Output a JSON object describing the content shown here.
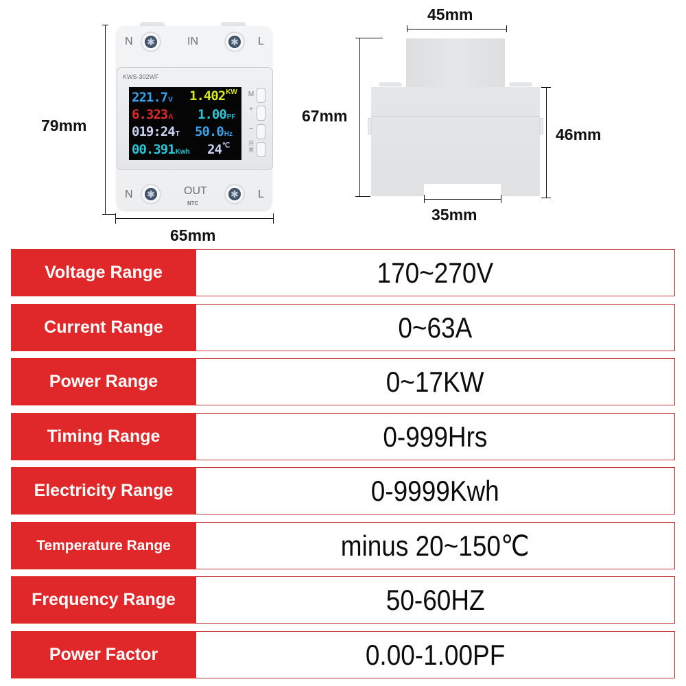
{
  "dimensions": {
    "front_height": "79mm",
    "front_width": "65mm",
    "side_top_width": "45mm",
    "side_total_height": "67mm",
    "side_body_height": "46mm",
    "rail_width": "35mm"
  },
  "device": {
    "model": "KWS-302WF",
    "top_terminals": {
      "left": "N",
      "center": "IN",
      "right": "L"
    },
    "bottom_terminals": {
      "left": "N",
      "center": "OUT",
      "sub": "NTC",
      "right": "L"
    },
    "buttons": [
      {
        "label": "M"
      },
      {
        "label": "+"
      },
      {
        "label": "−"
      },
      {
        "label": "开关"
      }
    ],
    "display": {
      "voltage": {
        "value": "221.7",
        "unit": "V",
        "color": "#3aa0e8"
      },
      "power": {
        "value": "1.402",
        "unit": "KW",
        "color": "#d8e81e"
      },
      "current": {
        "value": "6.323",
        "unit": "A",
        "color": "#e02a2a"
      },
      "power_factor": {
        "value": "1.00",
        "unit": "PF",
        "color": "#28c6d6"
      },
      "time": {
        "value": "019:24",
        "unit": "T",
        "color": "#c8d2f0"
      },
      "frequency": {
        "value": "50.0",
        "unit": "Hz",
        "color": "#3aa0e8"
      },
      "energy": {
        "value": "00.391",
        "unit": "Kwh",
        "color": "#28c6d6"
      },
      "temperature": {
        "value": "24",
        "unit": "℃",
        "color": "#c8d2f0"
      }
    }
  },
  "specs": [
    {
      "label": "Voltage Range",
      "value": "170~270V"
    },
    {
      "label": "Current Range",
      "value": "0~63A"
    },
    {
      "label": "Power Range",
      "value": "0~17KW"
    },
    {
      "label": "Timing Range",
      "value": "0-999Hrs"
    },
    {
      "label": "Electricity Range",
      "value": "0-9999Kwh"
    },
    {
      "label": "Temperature Range",
      "value": "minus 20~150℃"
    },
    {
      "label": "Frequency Range",
      "value": "50-60HZ"
    },
    {
      "label": "Power Factor",
      "value": "0.00-1.00PF"
    }
  ],
  "colors": {
    "label_bg": "#e0282a",
    "label_text": "#ffffff",
    "value_border": "#c0393b"
  }
}
